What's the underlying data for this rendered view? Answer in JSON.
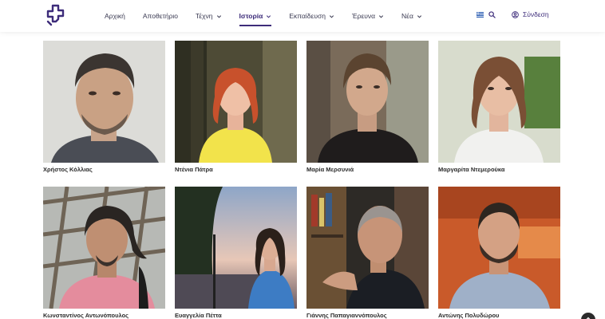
{
  "header": {
    "logo_icon": "cross-logo-icon",
    "brand_color": "#3d2c7a",
    "nav": [
      {
        "label": "Αρχική",
        "has_dropdown": false,
        "active": false
      },
      {
        "label": "Αποθετήριο",
        "has_dropdown": false,
        "active": false
      },
      {
        "label": "Τέχνη",
        "has_dropdown": true,
        "active": false
      },
      {
        "label": "Ιστορία",
        "has_dropdown": true,
        "active": true
      },
      {
        "label": "Εκπαίδευση",
        "has_dropdown": true,
        "active": false
      },
      {
        "label": "Έρευνα",
        "has_dropdown": true,
        "active": false
      },
      {
        "label": "Νέα",
        "has_dropdown": true,
        "active": false
      }
    ],
    "language_icon": "flag-icon",
    "search_icon": "search-icon",
    "login_label": "Σύνδεση"
  },
  "people": [
    {
      "name": "Χρήστος Κόλλιας"
    },
    {
      "name": "Ντένια Πάτρα"
    },
    {
      "name": "Μαρία Μερσυνιά"
    },
    {
      "name": "Μαργαρίτα Ντεμερούκα"
    },
    {
      "name": "Κωνσταντίνος Αντωνόπουλος"
    },
    {
      "name": "Ευαγγελία Πέττα"
    },
    {
      "name": "Γιάννης Παπαγιαννόπουλος"
    },
    {
      "name": "Αντώνης Πολυδώρου"
    }
  ]
}
